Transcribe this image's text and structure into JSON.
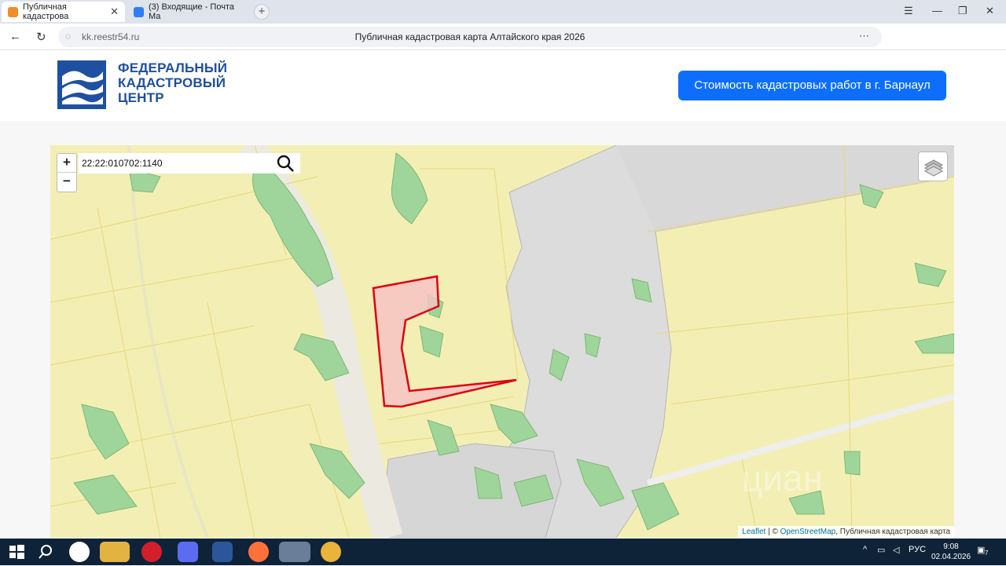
{
  "browser": {
    "tabs": [
      {
        "title": "Публичная кадастрова",
        "active": true
      },
      {
        "title": "(3) Входящие - Почта Ма",
        "active": false
      }
    ],
    "new_tab": "+",
    "url": "kk.reestr54.ru",
    "page_title": "Публичная кадастровая карта Алтайского края 2026"
  },
  "header": {
    "logo_lines": [
      "ФЕДЕРАЛЬНЫЙ",
      "КАДАСТРОВЫЙ",
      "ЦЕНТР"
    ],
    "cta_label": "Стоимость кадастровых работ в г. Барнаул"
  },
  "map": {
    "zoom_in": "+",
    "zoom_out": "−",
    "search_value": "22:22:010702:1140",
    "attribution": {
      "leaflet": "Leaflet",
      "sep": " | © ",
      "osm": "OpenStreetMap",
      "rest": ", Публичная кадастровая карта"
    },
    "colors": {
      "land": "#f3efb4",
      "forest": "#9fd49a",
      "urban": "#dcdcdc",
      "parcel_fill": "#f6c3c3",
      "parcel_stroke": "#e0000f"
    }
  },
  "taskbar": {
    "language": "РУС",
    "time": "9:08",
    "date": "02.04.2026",
    "notification_count": "7"
  }
}
